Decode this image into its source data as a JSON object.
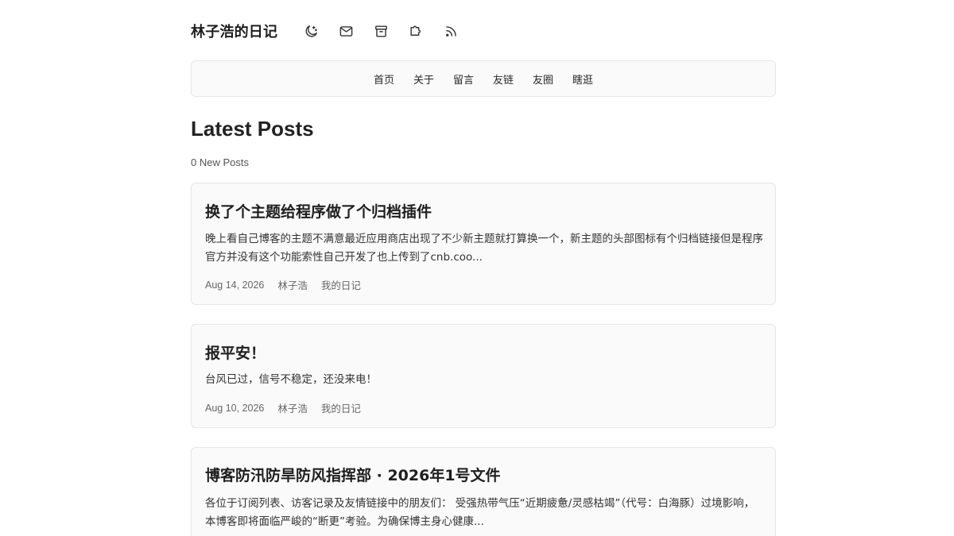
{
  "site": {
    "title": "林子浩的日记",
    "header_icons": [
      "moon-icon",
      "mail-icon",
      "archive-icon",
      "puzzle-icon",
      "rss-icon"
    ]
  },
  "nav": {
    "items": [
      {
        "label": "首页"
      },
      {
        "label": "关于"
      },
      {
        "label": "留言"
      },
      {
        "label": "友链"
      },
      {
        "label": "友圈"
      },
      {
        "label": "瞎逛"
      }
    ]
  },
  "main": {
    "heading": "Latest Posts",
    "new_posts": "0 New Posts",
    "posts": [
      {
        "title": "换了个主题给程序做了个归档插件",
        "excerpt": "晚上看自己博客的主题不满意最近应用商店出现了不少新主题就打算换一个，新主题的头部图标有个归档链接但是程序官方并没有这个功能索性自己开发了也上传到了cnb.coo...",
        "date": "Aug 14, 2026",
        "author": "林子浩",
        "category": "我的日记"
      },
      {
        "title": "报平安！",
        "excerpt": "台风已过，信号不稳定，还没来电！",
        "date": "Aug 10, 2026",
        "author": "林子浩",
        "category": "我的日记"
      },
      {
        "title": "博客防汛防旱防风指挥部 · 2026年1号文件",
        "excerpt": "各位于订阅列表、访客记录及友情链接中的朋友们： 受强热带气压“近期疲惫/灵感枯竭”（代号：白海豚）过境影响，本博客即将面临严峻的“断更”考验。为确保博主身心健康..."
      }
    ]
  },
  "colors": {
    "text": "#222222",
    "muted": "#666666",
    "card_bg": "#fafafa",
    "border": "#e6e6e6"
  }
}
